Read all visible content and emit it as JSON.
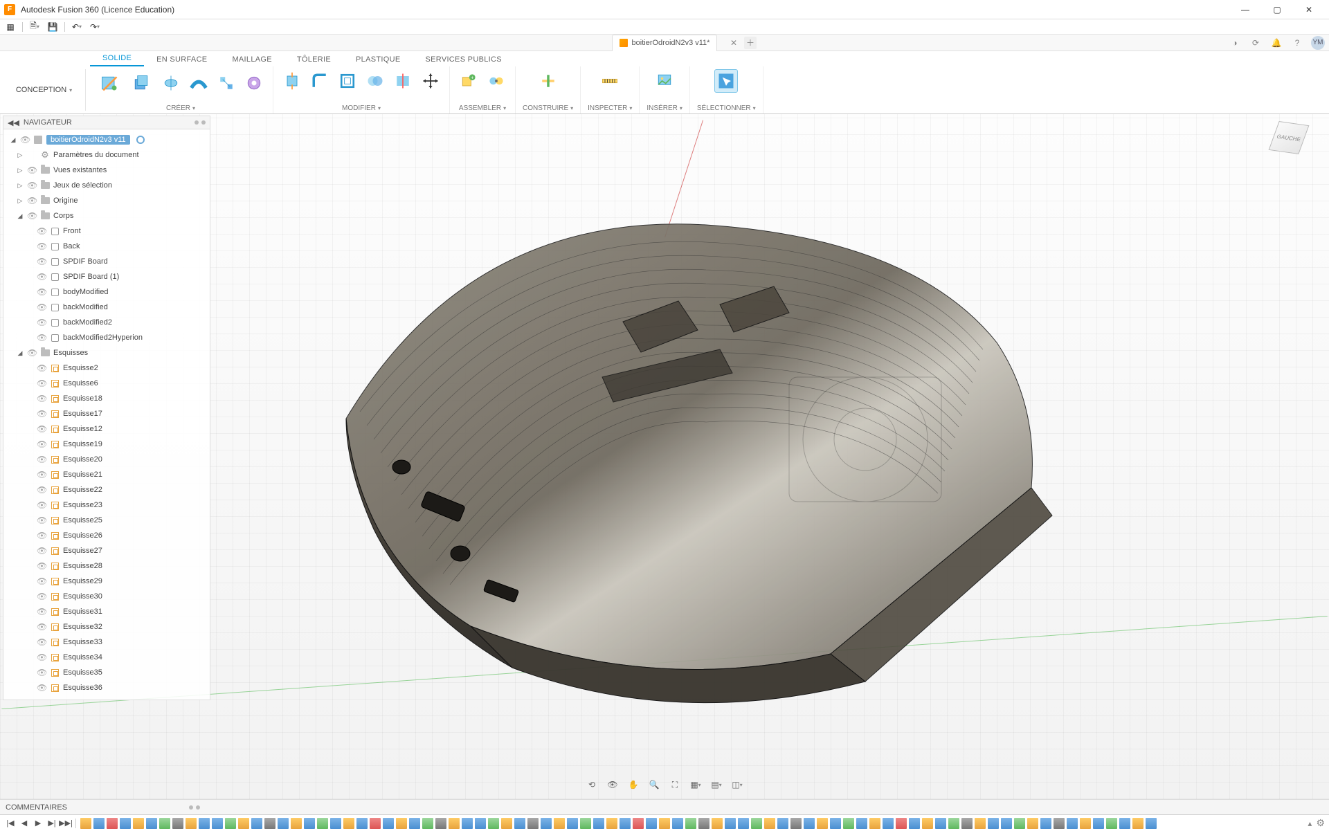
{
  "app": {
    "title": "Autodesk Fusion 360 (Licence Education)",
    "icon_letter": "F"
  },
  "window_controls": {
    "min": "—",
    "max": "▢",
    "close": "✕"
  },
  "doc_tab": {
    "name": "boitierOdroidN2v3 v11*"
  },
  "top_right": {
    "avatar": "YM"
  },
  "workspace": {
    "label": "CONCEPTION"
  },
  "ribbon_tabs": [
    "SOLIDE",
    "EN SURFACE",
    "MAILLAGE",
    "TÔLERIE",
    "PLASTIQUE",
    "SERVICES PUBLICS"
  ],
  "ribbon_active": 0,
  "ribbon_groups": {
    "creer": "CRÉER",
    "modifier": "MODIFIER",
    "assembler": "ASSEMBLER",
    "construire": "CONSTRUIRE",
    "inspecter": "INSPECTER",
    "inserer": "INSÉRER",
    "selectionner": "SÉLECTIONNER"
  },
  "browser": {
    "title": "NAVIGATEUR",
    "collapse": "◀◀",
    "root": "boitierOdroidN2v3 v11",
    "items_top": [
      {
        "label": "Paramètres du document",
        "icon": "gear"
      },
      {
        "label": "Vues existantes",
        "icon": "folder"
      },
      {
        "label": "Jeux de sélection",
        "icon": "folder"
      },
      {
        "label": "Origine",
        "icon": "folder"
      }
    ],
    "corps": {
      "label": "Corps",
      "children": [
        "Front",
        "Back",
        "SPDIF Board",
        "SPDIF Board (1)",
        "bodyModified",
        "backModified",
        "backModified2",
        "backModified2Hyperion"
      ]
    },
    "esquisses": {
      "label": "Esquisses",
      "children": [
        "Esquisse2",
        "Esquisse6",
        "Esquisse18",
        "Esquisse17",
        "Esquisse12",
        "Esquisse19",
        "Esquisse20",
        "Esquisse21",
        "Esquisse22",
        "Esquisse23",
        "Esquisse25",
        "Esquisse26",
        "Esquisse27",
        "Esquisse28",
        "Esquisse29",
        "Esquisse30",
        "Esquisse31",
        "Esquisse32",
        "Esquisse33",
        "Esquisse34",
        "Esquisse35",
        "Esquisse36"
      ]
    }
  },
  "comments": {
    "label": "COMMENTAIRES"
  },
  "viewcube": {
    "face": "GAUCHE"
  },
  "timeline_features_count": 82
}
